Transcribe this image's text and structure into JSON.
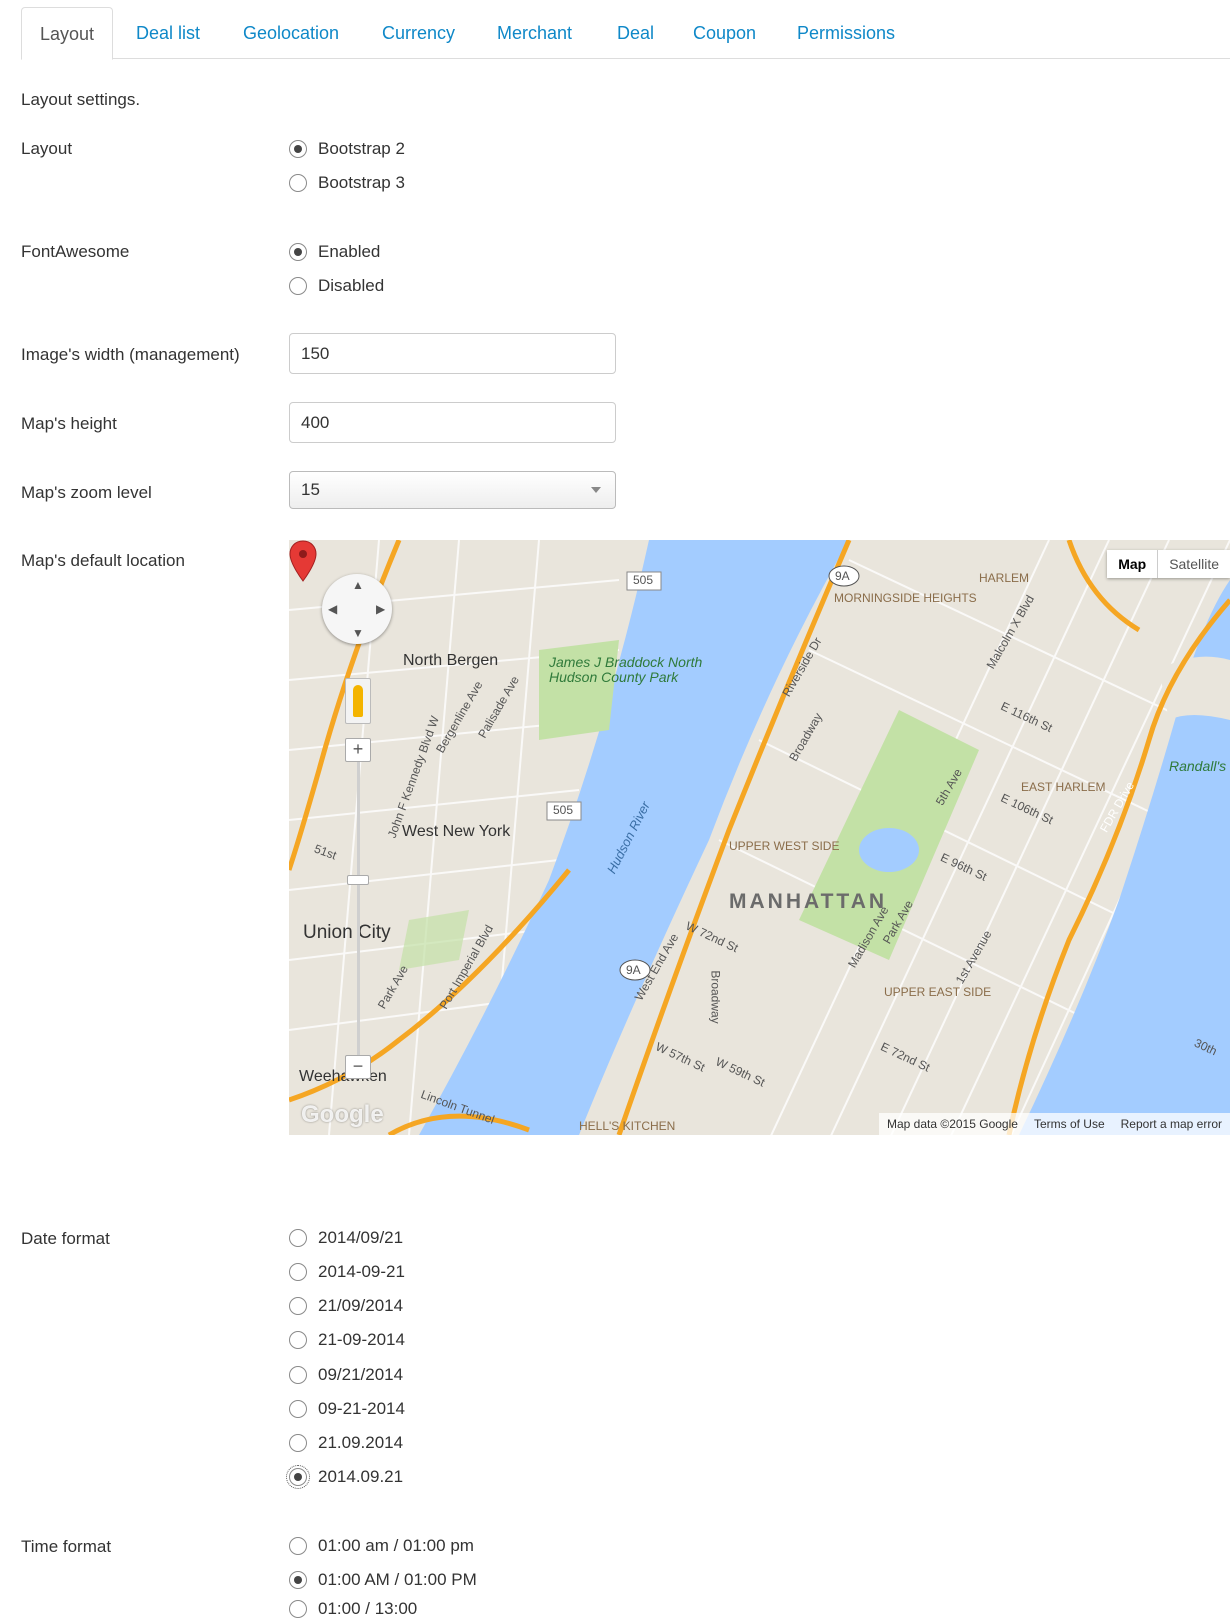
{
  "tabs": [
    {
      "label": "Layout",
      "active": true
    },
    {
      "label": "Deal list"
    },
    {
      "label": "Geolocation"
    },
    {
      "label": "Currency"
    },
    {
      "label": "Merchant"
    },
    {
      "label": "Deal"
    },
    {
      "label": "Coupon"
    },
    {
      "label": "Permissions"
    }
  ],
  "intro": "Layout settings.",
  "layout": {
    "label": "Layout",
    "options": [
      "Bootstrap 2",
      "Bootstrap 3"
    ],
    "selected": "Bootstrap 2"
  },
  "fontawesome": {
    "label": "FontAwesome",
    "options": [
      "Enabled",
      "Disabled"
    ],
    "selected": "Enabled"
  },
  "image_width": {
    "label": "Image's width (management)",
    "value": "150"
  },
  "map_height": {
    "label": "Map's height",
    "value": "400"
  },
  "map_zoom": {
    "label": "Map's zoom level",
    "value": "15"
  },
  "map_location": {
    "label": "Map's default location",
    "type_controls": {
      "map": "Map",
      "satellite": "Satellite"
    },
    "zoom_in": "+",
    "zoom_out": "−",
    "place_labels": {
      "north_bergen": "North Bergen",
      "park": "James J Braddock North Hudson County Park",
      "west_new_york": "West New York",
      "union_city": "Union City",
      "weehawken": "Weehawken",
      "hudson_river": "Hudson River",
      "manhattan": "MANHATTAN",
      "upper_west_side": "UPPER WEST SIDE",
      "upper_east_side": "UPPER EAST SIDE",
      "morningside_heights": "MORNINGSIDE HEIGHTS",
      "harlem": "HARLEM",
      "east_harlem": "EAST HARLEM",
      "hells_kitchen": "HELL'S KITCHEN",
      "randalls": "Randall's",
      "route_505": "505",
      "route_9a": "9A",
      "broadway": "Broadway",
      "fdr_drive": "FDR Drive",
      "e_96th": "E 96th St",
      "e_106th": "E 106th St",
      "e_116th": "E 116th St",
      "w_72nd": "W 72nd St",
      "w_57th": "W 57th St",
      "w_59th": "W 59th St",
      "park_ave_ue": "Park Ave",
      "madison_ave": "Madison Ave",
      "first_ave": "1st Avenue",
      "fifth_ave": "5th Ave",
      "riverside_dr": "Riverside Dr",
      "malcolm_x": "Malcolm X Blvd",
      "west_end_ave": "West End Ave",
      "bergenline": "Bergenline Ave",
      "palisade": "Palisade Ave",
      "jfk_blvd": "John F Kennedy Blvd W",
      "port_imperial": "Port Imperial Blvd",
      "park_ave_nj": "Park Ave",
      "lincoln": "Lincoln Tunnel",
      "e_72nd": "E 72nd St",
      "thirtieth": "30th",
      "fiftyfirst": "51st"
    },
    "footer": {
      "map_data": "Map data ©2015 Google",
      "terms": "Terms of Use",
      "report": "Report a map error"
    },
    "logo": "Google"
  },
  "date_format": {
    "label": "Date format",
    "options": [
      "2014/09/21",
      "2014-09-21",
      "21/09/2014",
      "21-09-2014",
      "09/21/2014",
      "09-21-2014",
      "21.09.2014",
      "2014.09.21"
    ],
    "selected": "2014.09.21"
  },
  "time_format": {
    "label": "Time format",
    "options": [
      "01:00 am / 01:00 pm",
      "01:00 AM / 01:00 PM",
      "01:00 / 13:00"
    ],
    "selected": "01:00 AM / 01:00 PM"
  },
  "colors": {
    "tab_link": "#0f88c8",
    "water": "#a3ccff",
    "park": "#c3e1a6",
    "land": "#e9e5dc",
    "highway": "#f5a623",
    "marker": "#e53935"
  }
}
